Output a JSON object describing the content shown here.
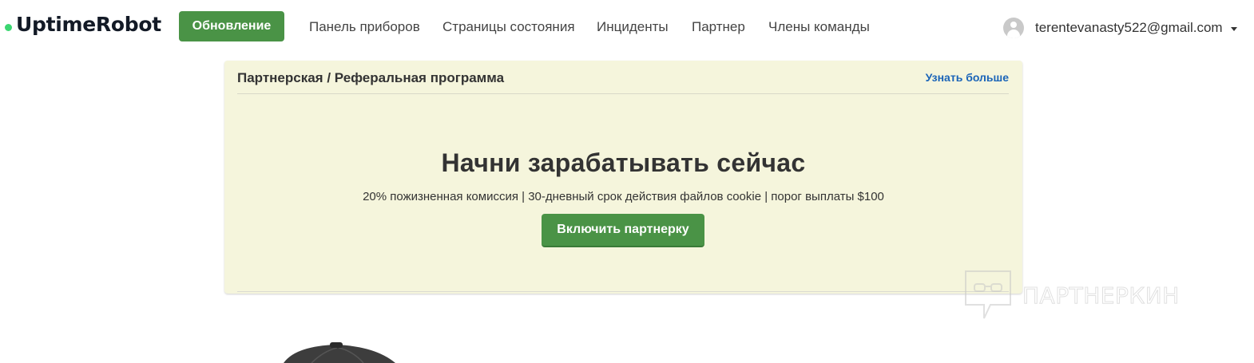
{
  "app": {
    "logo_text": "UptimeRobot",
    "brand_color": "#3bd671",
    "accent_color": "#4a9346"
  },
  "nav": {
    "upgrade_label": "Обновление",
    "links": [
      "Панель приборов",
      "Страницы состояния",
      "Инциденты",
      "Партнер",
      "Члены команды"
    ],
    "user_email": "terentevanasty522@gmail.com",
    "user_icon": "user-avatar-icon",
    "caret_icon": "caret-down-icon"
  },
  "panel": {
    "title": "Партнерская / Реферальная программа",
    "learn_more_label": "Узнать больше",
    "headline": "Начни зарабатывать сейчас",
    "subline": "20% пожизненная комиссия | 30-дневный срок действия файлов cookie | порог выплаты $100",
    "cta_label": "Включить партнерку",
    "background_color": "#f5f5dc"
  },
  "watermark": {
    "text": "ПАРТНЕРКИН",
    "icon": "chat-bubble-glasses-icon"
  }
}
